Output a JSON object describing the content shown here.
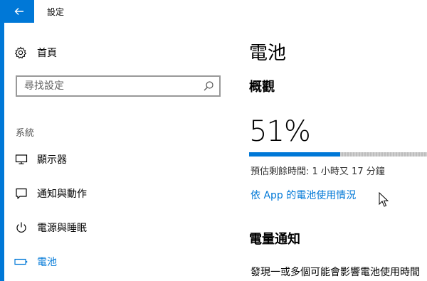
{
  "window": {
    "title": "設定"
  },
  "sidebar": {
    "home_label": "首頁",
    "search_placeholder": "尋找設定",
    "section_label": "系統",
    "items": [
      {
        "label": "顯示器",
        "icon": "monitor-icon",
        "active": false
      },
      {
        "label": "通知與動作",
        "icon": "notification-icon",
        "active": false
      },
      {
        "label": "電源與睡眠",
        "icon": "power-icon",
        "active": false
      },
      {
        "label": "電池",
        "icon": "battery-icon",
        "active": true
      }
    ]
  },
  "main": {
    "title": "電池",
    "overview_label": "概觀",
    "battery_percent": "51%",
    "battery_level": 0.51,
    "estimate_text": "預估剩餘時間: 1 小時又 17 分鐘",
    "usage_link": "依 App 的電池使用情況",
    "notification_title": "電量通知",
    "notification_desc": "發現一或多個可能會影響電池使用時間"
  },
  "colors": {
    "accent": "#0078d7",
    "bar_remaining": "#c8c8c8"
  }
}
